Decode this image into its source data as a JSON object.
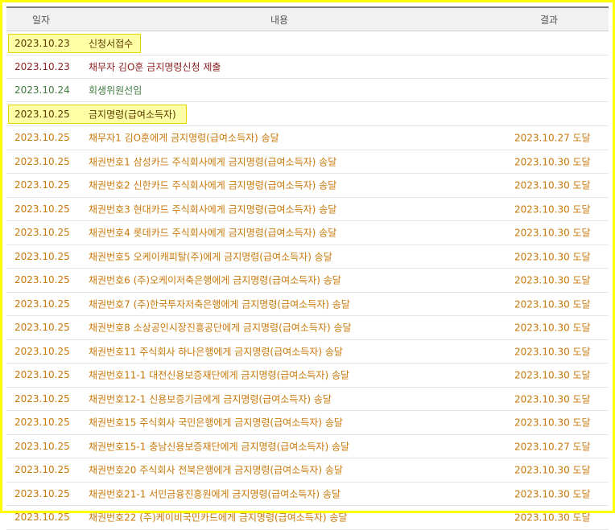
{
  "header": {
    "date": "일자",
    "content": "내용",
    "result": "결과"
  },
  "colors": {
    "orange": "#c8780a",
    "dark_red": "#8b1e1e",
    "green": "#3f7a3f",
    "dark_text": "#5a3a00"
  },
  "rows": [
    {
      "date": "2023.10.23",
      "content": "신청서접수",
      "result": "",
      "highlight": true,
      "tone": "dark"
    },
    {
      "date": "2023.10.23",
      "content": "채무자 김O훈 금지명령신청 제출",
      "result": "",
      "highlight": false,
      "tone": "darkred"
    },
    {
      "date": "2023.10.24",
      "content": "회생위원선임",
      "result": "",
      "highlight": false,
      "tone": "green"
    },
    {
      "date": "2023.10.25",
      "content": "금지명령(급여소득자)",
      "result": "",
      "highlight": true,
      "tone": "dark"
    },
    {
      "date": "2023.10.25",
      "content": "채무자1 김O훈에게 금지명령(급여소득자) 송달",
      "result": "2023.10.27 도달",
      "highlight": false,
      "tone": "orange"
    },
    {
      "date": "2023.10.25",
      "content": "채권번호1 삼성카드 주식회사에게 금지명령(급여소득자) 송달",
      "result": "2023.10.30 도달",
      "highlight": false,
      "tone": "orange"
    },
    {
      "date": "2023.10.25",
      "content": "채권번호2 신한카드 주식회사에게 금지명령(급여소득자) 송달",
      "result": "2023.10.30 도달",
      "highlight": false,
      "tone": "orange"
    },
    {
      "date": "2023.10.25",
      "content": "채권번호3 현대카드 주식회사에게 금지명령(급여소득자) 송달",
      "result": "2023.10.30 도달",
      "highlight": false,
      "tone": "orange"
    },
    {
      "date": "2023.10.25",
      "content": "채권번호4 롯데카드 주식회사에게 금지명령(급여소득자) 송달",
      "result": "2023.10.30 도달",
      "highlight": false,
      "tone": "orange"
    },
    {
      "date": "2023.10.25",
      "content": "채권번호5 오케이캐피탈(주)에게 금지명령(급여소득자) 송달",
      "result": "2023.10.30 도달",
      "highlight": false,
      "tone": "orange"
    },
    {
      "date": "2023.10.25",
      "content": "채권번호6 (주)오케이저축은행에게 금지명령(급여소득자) 송달",
      "result": "2023.10.30 도달",
      "highlight": false,
      "tone": "orange"
    },
    {
      "date": "2023.10.25",
      "content": "채권번호7 (주)한국투자저축은행에게 금지명령(급여소득자) 송달",
      "result": "2023.10.30 도달",
      "highlight": false,
      "tone": "orange"
    },
    {
      "date": "2023.10.25",
      "content": "채권번호8 소상공인시장진흥공단에게 금지명령(급여소득자) 송달",
      "result": "2023.10.30 도달",
      "highlight": false,
      "tone": "orange"
    },
    {
      "date": "2023.10.25",
      "content": "채권번호11 주식회사 하나은행에게 금지명령(급여소득자) 송달",
      "result": "2023.10.30 도달",
      "highlight": false,
      "tone": "orange"
    },
    {
      "date": "2023.10.25",
      "content": "채권번호11-1 대전신용보증재단에게 금지명령(급여소득자) 송달",
      "result": "2023.10.30 도달",
      "highlight": false,
      "tone": "orange"
    },
    {
      "date": "2023.10.25",
      "content": "채권번호12-1 신용보증기금에게 금지명령(급여소득자) 송달",
      "result": "2023.10.30 도달",
      "highlight": false,
      "tone": "orange"
    },
    {
      "date": "2023.10.25",
      "content": "채권번호15 주식회사 국민은행에게 금지명령(급여소득자) 송달",
      "result": "2023.10.30 도달",
      "highlight": false,
      "tone": "orange"
    },
    {
      "date": "2023.10.25",
      "content": "채권번호15-1 충남신용보증재단에게 금지명령(급여소득자) 송달",
      "result": "2023.10.27 도달",
      "highlight": false,
      "tone": "orange"
    },
    {
      "date": "2023.10.25",
      "content": "채권번호20 주식회사 전북은행에게 금지명령(급여소득자) 송달",
      "result": "2023.10.30 도달",
      "highlight": false,
      "tone": "orange"
    },
    {
      "date": "2023.10.25",
      "content": "채권번호21-1 서민금융진흥원에게 금지명령(급여소득자) 송달",
      "result": "2023.10.30 도달",
      "highlight": false,
      "tone": "orange"
    },
    {
      "date": "2023.10.25",
      "content": "채권번호22 (주)케이비국민카드에게 금지명령(급여소득자) 송달",
      "result": "2023.10.30 도달",
      "highlight": false,
      "tone": "orange"
    }
  ]
}
